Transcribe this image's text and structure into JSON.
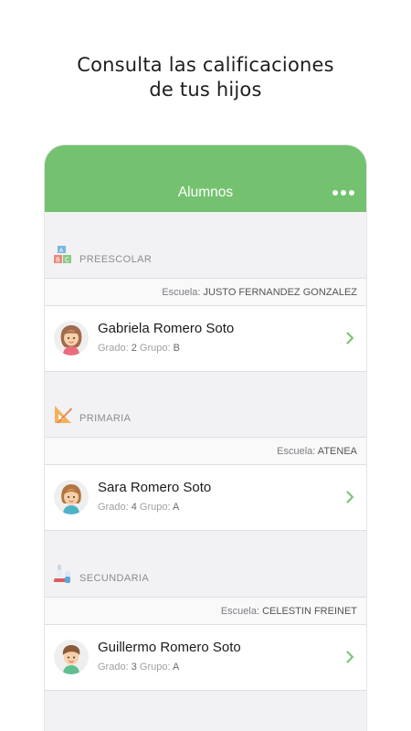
{
  "headline": {
    "line1": "Consulta las calificaciones",
    "line2": "de tus hijos"
  },
  "navbar": {
    "title": "Alumnos",
    "menu_icon": "more-dots-icon"
  },
  "colors": {
    "accent": "#74c26f",
    "background": "#f2f2f4",
    "chevron": "#74c26f"
  },
  "sections": [
    {
      "label": "PREESCOLAR",
      "icon": "abc-blocks-icon",
      "school_label": "Escuela:",
      "school": "JUSTO FERNANDEZ GONZALEZ",
      "student": {
        "name": "Gabriela Romero Soto",
        "grade_label": "Grado:",
        "grade": "2",
        "group_label": "Grupo:",
        "group": "B",
        "avatar": "girl-avatar-icon"
      }
    },
    {
      "label": "PRIMARIA",
      "icon": "ruler-triangle-icon",
      "school_label": "Escuela:",
      "school": "ATENEA",
      "student": {
        "name": "Sara Romero Soto",
        "grade_label": "Grado:",
        "grade": "4",
        "group_label": "Grupo:",
        "group": "A",
        "avatar": "girl-avatar-icon"
      }
    },
    {
      "label": "SECUNDARIA",
      "icon": "flask-icon",
      "school_label": "Escuela:",
      "school": "CELESTIN FREINET",
      "student": {
        "name": "Guillermo Romero Soto",
        "grade_label": "Grado:",
        "grade": "3",
        "group_label": "Grupo:",
        "group": "A",
        "avatar": "boy-avatar-icon"
      }
    }
  ]
}
